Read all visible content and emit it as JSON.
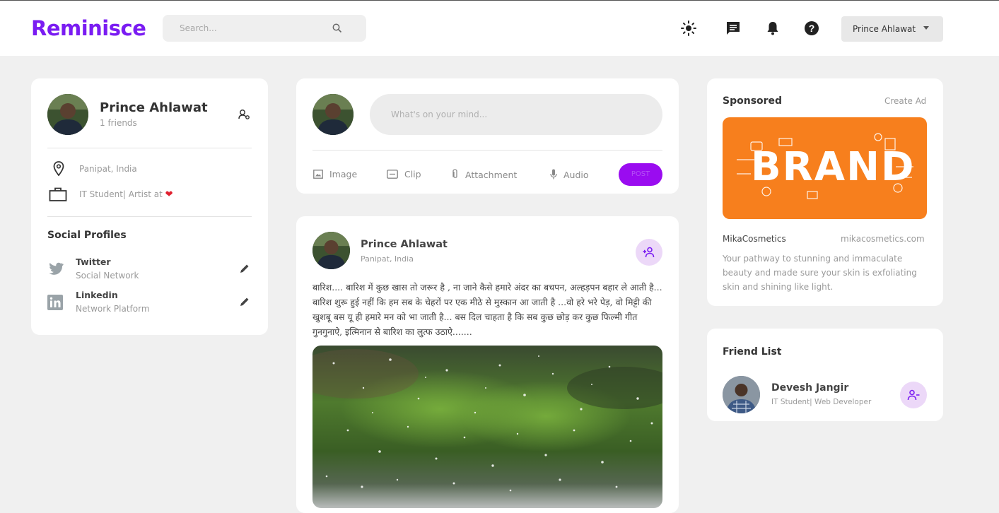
{
  "app": {
    "logo": "Reminisce"
  },
  "search": {
    "placeholder": "Search..."
  },
  "nav": {
    "user_name": "Prince Ahlawat",
    "icons": [
      "sun-icon",
      "message-icon",
      "bell-icon",
      "help-icon"
    ]
  },
  "profile": {
    "name": "Prince Ahlawat",
    "friends": "1 friends",
    "location": "Panipat, India",
    "occupation": "IT Student| Artist at",
    "social_heading": "Social Profiles",
    "socials": [
      {
        "name": "Twitter",
        "type": "Social Network"
      },
      {
        "name": "Linkedin",
        "type": "Network Platform"
      }
    ]
  },
  "composer": {
    "placeholder": "What's on your mind...",
    "actions": [
      "Image",
      "Clip",
      "Attachment",
      "Audio"
    ],
    "post_button": "POST"
  },
  "post": {
    "author": "Prince Ahlawat",
    "location": "Panipat, India",
    "text": "बारिश.... बारिश में कुछ खास तो जरूर है , ना जाने कैसे हमारे अंदर का बचपन, अल्हड़पन बहार ले आती है... बारिश शुरू हुई नहीं कि हम सब के चेहरों पर एक मीठे से मुस्कान आ जाती है ...वो हरे भरे पेड़, वो मिट्टी की खुशबू बस यू ही हमारे मन को भा जाती है... बस दिल चाहता है कि सब कुछ छोड़ कर कुछ फिल्मी गीत गुनगुनाऐ, इत्मिनान से बारिश का लुत्फ उठाऐ......."
  },
  "sponsored": {
    "heading": "Sponsored",
    "create_ad": "Create Ad",
    "ad_image_text": "BRAND",
    "brand": "MikaCosmetics",
    "url": "mikacosmetics.com",
    "description": "Your pathway to stunning and immaculate beauty and made sure your skin is exfoliating skin and shining like light."
  },
  "friend_list": {
    "heading": "Friend List",
    "friends": [
      {
        "name": "Devesh Jangir",
        "subtitle": "IT Student| Web Developer"
      }
    ]
  },
  "colors": {
    "accent": "#7a1cf2",
    "post_button": "#9a0cf0",
    "ad_orange": "#f77f1d"
  }
}
